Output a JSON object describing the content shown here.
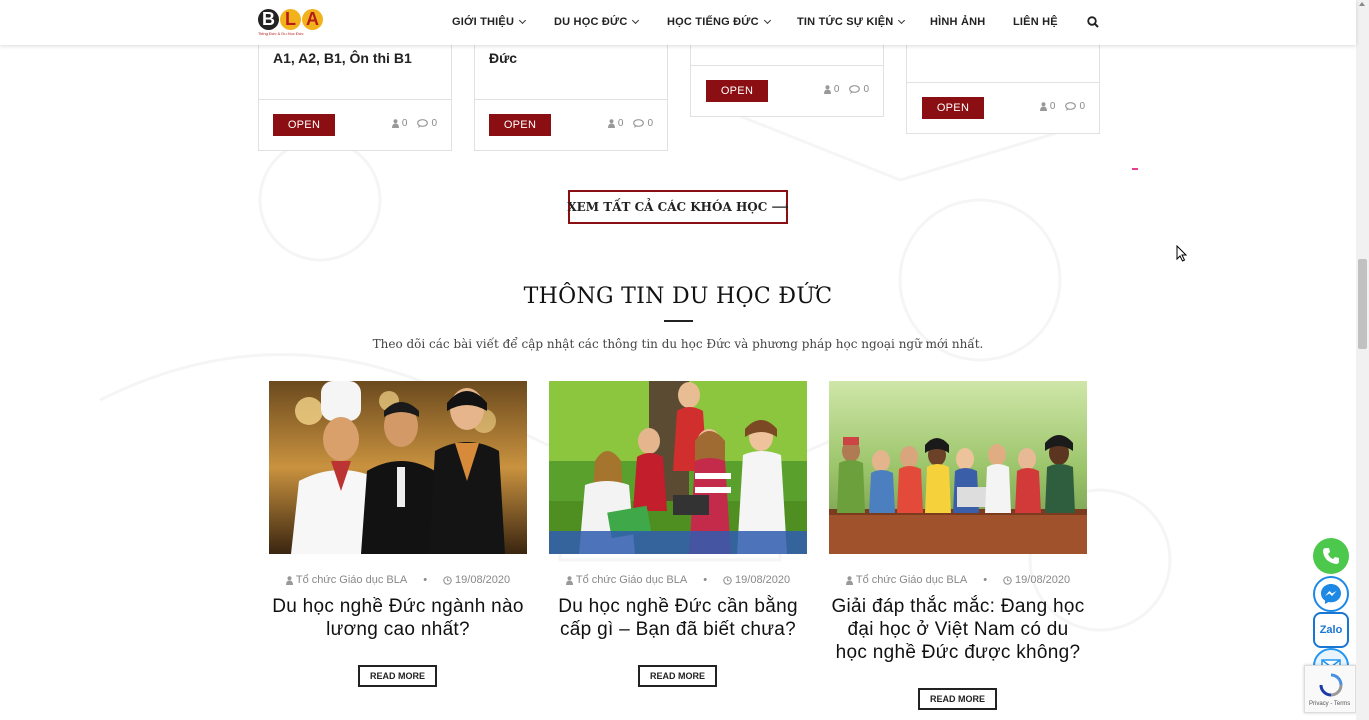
{
  "header": {
    "logo": {
      "letters": [
        "B",
        "L",
        "A"
      ],
      "tagline": "Tiếng Đức & Du Học Đức"
    },
    "nav": [
      {
        "label": "GIỚI THIỆU",
        "dropdown": true
      },
      {
        "label": "DU HỌC ĐỨC",
        "dropdown": true
      },
      {
        "label": "HỌC TIẾNG ĐỨC",
        "dropdown": true
      },
      {
        "label": "TIN TỨC SỰ KIỆN",
        "dropdown": true
      },
      {
        "label": "HÌNH ẢNH",
        "dropdown": false
      },
      {
        "label": "LIÊN HỆ",
        "dropdown": false
      }
    ],
    "search_icon": "search-icon"
  },
  "courses": [
    {
      "title": "A1, A2, B1, Ôn thi B1",
      "open_label": "OPEN",
      "members": "0",
      "comments": "0"
    },
    {
      "title": "Đức",
      "open_label": "OPEN",
      "members": "0",
      "comments": "0"
    },
    {
      "title": "",
      "open_label": "OPEN",
      "members": "0",
      "comments": "0"
    },
    {
      "title": "",
      "open_label": "OPEN",
      "members": "0",
      "comments": "0"
    }
  ],
  "view_all_label": "XEM TẤT CẢ CÁC KHÓA HỌC ⟶",
  "section": {
    "title": "THÔNG TIN DU HỌC ĐỨC",
    "description": "Theo dõi các bài viết để cập nhật các thông tin du học Đức và phương pháp học ngoại ngữ mới nhất."
  },
  "posts": [
    {
      "author": "Tổ chức Giáo dục BLA",
      "date": "19/08/2020",
      "title": "Du học nghề Đức ngành nào lương cao nhất?",
      "read_more": "READ MORE"
    },
    {
      "author": "Tổ chức Giáo dục BLA",
      "date": "19/08/2020",
      "title": "Du học nghề Đức cần bằng cấp gì – Bạn đã biết chưa?",
      "read_more": "READ MORE"
    },
    {
      "author": "Tổ chức Giáo dục BLA",
      "date": "19/08/2020",
      "title": "Giải đáp thắc mắc: Đang học đại học ở Việt Nam có du học nghề Đức được không?",
      "read_more": "READ MORE"
    }
  ],
  "floating": {
    "phone_icon": "phone-icon",
    "messenger_icon": "messenger-icon",
    "zalo_label": "Zalo",
    "mail_icon": "mail-icon"
  },
  "recaptcha": {
    "text": "Privacy - Terms"
  },
  "colors": {
    "brand_red": "#8b0f12",
    "logo_yellow": "#f2b21b",
    "phone_green": "#4cc94c",
    "messenger_blue": "#1e88e5",
    "zalo_blue": "#1976d2",
    "mail_blue": "#2196f3"
  }
}
